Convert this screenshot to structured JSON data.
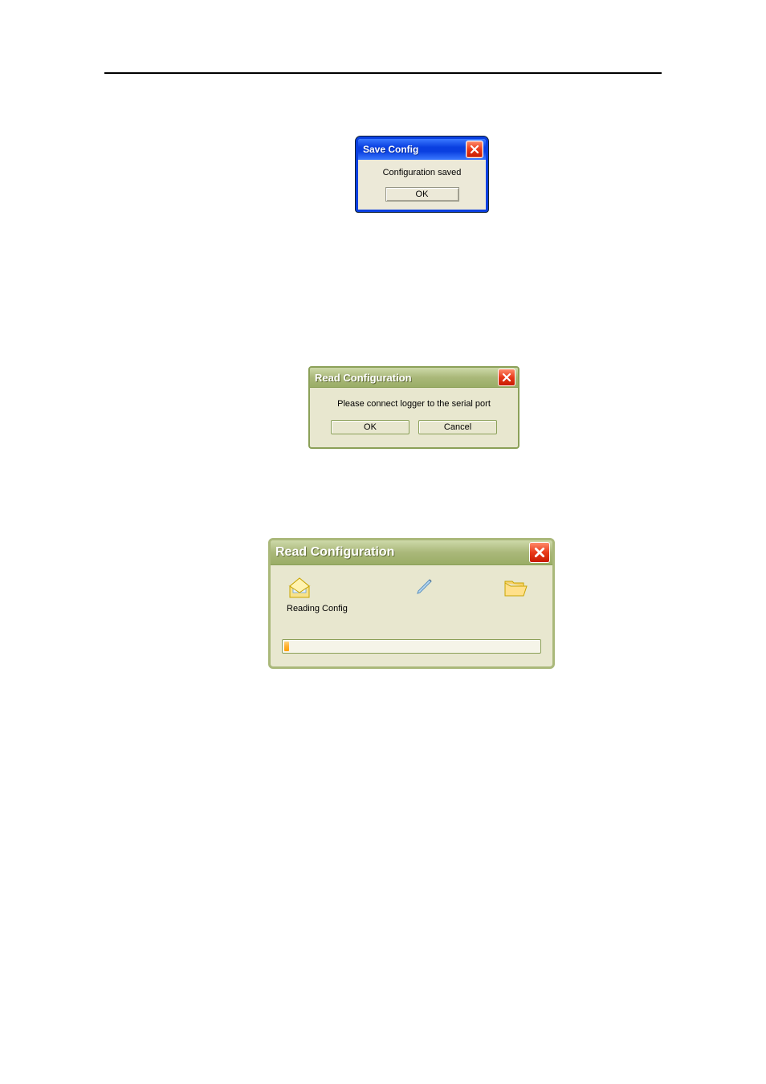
{
  "dialog1": {
    "title": "Save Config",
    "message": "Configuration saved",
    "ok": "OK"
  },
  "dialog2": {
    "title": "Read Configuration",
    "message": "Please connect logger to the serial port",
    "ok": "OK",
    "cancel": "Cancel"
  },
  "dialog3": {
    "title": "Read Configuration",
    "status": "Reading Config",
    "progress_percent": 2
  }
}
